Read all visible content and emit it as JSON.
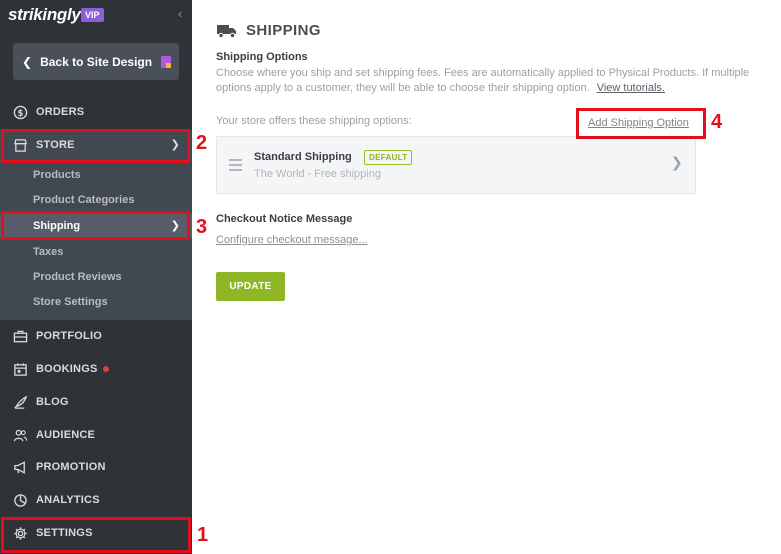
{
  "brand": {
    "logo_text": "strikingly",
    "vip_badge": "VIP"
  },
  "sidebar": {
    "back_label": "Back to Site Design",
    "items": [
      {
        "label": "ORDERS",
        "icon": "dollar-circle-icon"
      },
      {
        "label": "STORE",
        "icon": "store-icon"
      },
      {
        "label": "PORTFOLIO",
        "icon": "briefcase-icon"
      },
      {
        "label": "BOOKINGS",
        "icon": "calendar-icon"
      },
      {
        "label": "BLOG",
        "icon": "quill-icon"
      },
      {
        "label": "AUDIENCE",
        "icon": "people-icon"
      },
      {
        "label": "PROMOTION",
        "icon": "megaphone-icon"
      },
      {
        "label": "ANALYTICS",
        "icon": "pie-chart-icon"
      },
      {
        "label": "SETTINGS",
        "icon": "gear-icon"
      }
    ],
    "store_subitems": [
      {
        "label": "Products"
      },
      {
        "label": "Product Categories"
      },
      {
        "label": "Shipping"
      },
      {
        "label": "Taxes"
      },
      {
        "label": "Product Reviews"
      },
      {
        "label": "Store Settings"
      }
    ]
  },
  "main": {
    "title": "SHIPPING",
    "options_heading": "Shipping Options",
    "description": "Choose where you ship and set shipping fees. Fees are automatically applied to Physical Products. If multiple options apply to a customer, they will be able to choose their shipping option.",
    "tutorial_link": "View tutorials.",
    "offers_text": "Your store offers these shipping options:",
    "add_option": "Add Shipping Option",
    "shipping_option": {
      "name": "Standard Shipping",
      "badge": "DEFAULT",
      "region": "The World - Free shipping"
    },
    "checkout_heading": "Checkout Notice Message",
    "configure_link": "Configure checkout message...",
    "update_button": "UPDATE"
  },
  "annotations": [
    "1",
    "2",
    "3",
    "4"
  ],
  "colors": {
    "sidebar_bg": "#2f3236",
    "accent_green": "#8fb625",
    "callout_red": "#e3101b",
    "vip_purple": "#8b5fd6"
  }
}
